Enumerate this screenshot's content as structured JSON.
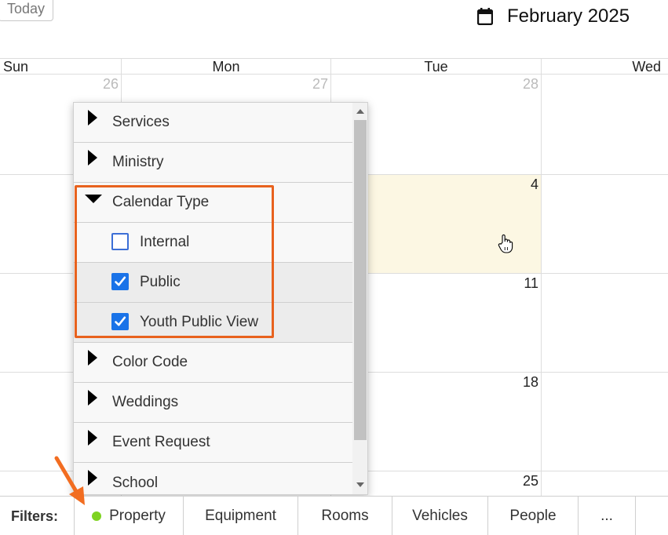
{
  "header": {
    "today_label": "Today",
    "month_title": "February 2025"
  },
  "calendar": {
    "day_headers": [
      "Sun",
      "Mon",
      "Tue",
      "Wed"
    ],
    "prev_month_days": [
      "26",
      "27",
      "28"
    ],
    "dates": [
      "4",
      "11",
      "18",
      "25"
    ]
  },
  "filter_dropdown": {
    "groups": [
      {
        "label": "Services",
        "expanded": false
      },
      {
        "label": "Ministry",
        "expanded": false
      },
      {
        "label": "Calendar Type",
        "expanded": true,
        "options": [
          {
            "label": "Internal",
            "checked": false
          },
          {
            "label": "Public",
            "checked": true
          },
          {
            "label": "Youth Public View",
            "checked": true
          }
        ]
      },
      {
        "label": "Color Code",
        "expanded": false
      },
      {
        "label": "Weddings",
        "expanded": false
      },
      {
        "label": "Event Request",
        "expanded": false
      },
      {
        "label": "School",
        "expanded": false
      }
    ]
  },
  "filters_bar": {
    "label": "Filters:",
    "tabs": [
      "Property",
      "Equipment",
      "Rooms",
      "Vehicles",
      "People",
      "..."
    ],
    "active_indicator_color": "#7ed321"
  },
  "colors": {
    "highlight": "#e8621e",
    "today_bg": "#fcf7e3",
    "checkbox": "#1a73e8"
  }
}
